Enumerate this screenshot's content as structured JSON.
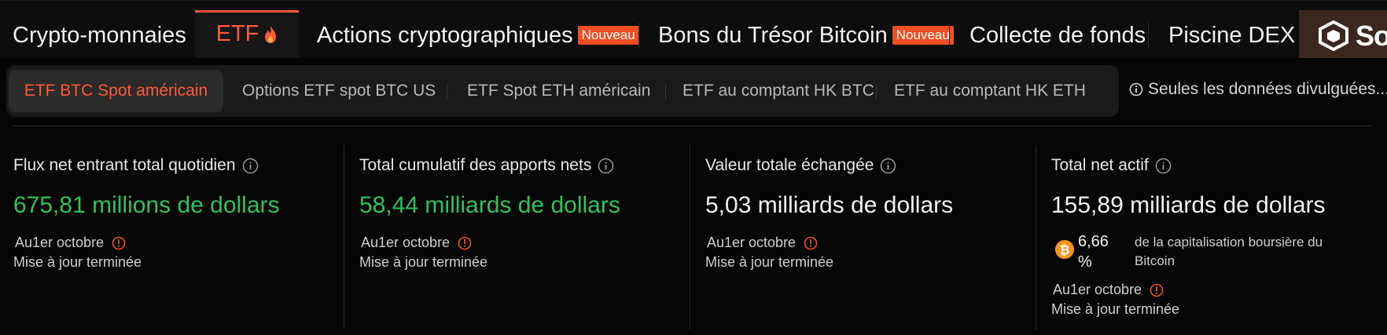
{
  "topnav": {
    "items": [
      {
        "label": "Crypto-monnaies"
      },
      {
        "label": "ETF"
      },
      {
        "label": "Actions cryptographiques",
        "badge": "Nouveau"
      },
      {
        "label": "Bons du Trésor Bitcoin",
        "badge": "Nouveau"
      },
      {
        "label": "Collecte de fonds"
      },
      {
        "label": "Piscine DEX"
      }
    ],
    "promo_text": "So",
    "accent": "#ff5a36"
  },
  "subtabs": {
    "items": [
      {
        "label": "ETF BTC Spot américain"
      },
      {
        "label": "Options ETF spot BTC US"
      },
      {
        "label": "ETF Spot ETH américain"
      },
      {
        "label": "ETF au comptant HK BTC"
      },
      {
        "label": "ETF au comptant HK ETH"
      }
    ],
    "disclosure": "Seules les données divulguées..."
  },
  "cards": [
    {
      "label": "Flux net entrant total quotidien",
      "value": "675,81 millions de dollars",
      "value_color": "#2fc25b",
      "date": "Au1er octobre",
      "status": "Mise à jour terminée"
    },
    {
      "label": "Total cumulatif des apports nets",
      "value": "58,44 milliards de dollars",
      "value_color": "#2fc25b",
      "date": "Au1er octobre",
      "status": "Mise à jour terminée"
    },
    {
      "label": "Valeur totale échangée",
      "value": "5,03 milliards de dollars",
      "value_color": "#f2f2f2",
      "date": "Au1er octobre",
      "status": "Mise à jour terminée"
    },
    {
      "label": "Total net actif",
      "value": "155,89 milliards de dollars",
      "value_color": "#f2f2f2",
      "share_pct": "6,66 %",
      "share_desc": "de la capitalisation boursière du Bitcoin",
      "date": "Au1er octobre",
      "status": "Mise à jour terminée"
    }
  ],
  "icons": {
    "etf_flame": "flame-icon",
    "info": "info-icon",
    "question": "question-circle-icon",
    "alert": "red-info-icon",
    "bitcoin": "bitcoin-icon",
    "promo_logo": "cube-logo-icon"
  }
}
